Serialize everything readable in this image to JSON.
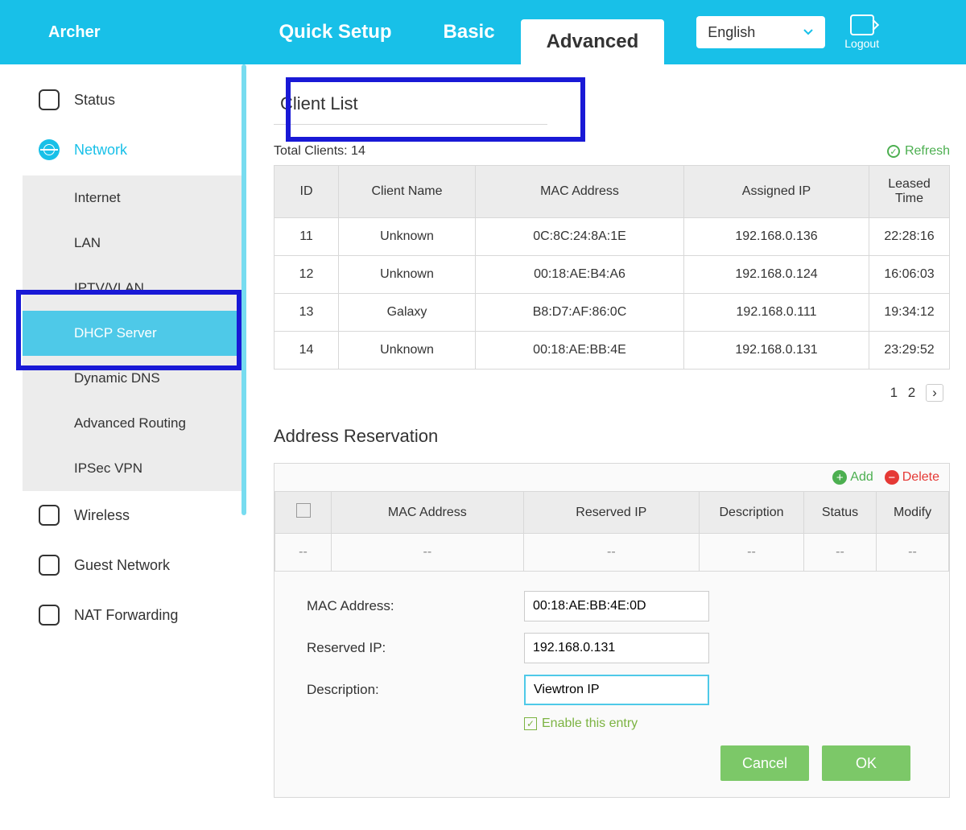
{
  "brand": "Archer",
  "tabs": {
    "quick": "Quick Setup",
    "basic": "Basic",
    "advanced": "Advanced"
  },
  "lang": {
    "value": "English"
  },
  "logout": "Logout",
  "sidebar": {
    "status": "Status",
    "network": "Network",
    "subs": {
      "internet": "Internet",
      "lan": "LAN",
      "iptv": "IPTV/VLAN",
      "dhcp": "DHCP Server",
      "ddns": "Dynamic DNS",
      "advrouting": "Advanced Routing",
      "ipsec": "IPSec VPN"
    },
    "wireless": "Wireless",
    "guest": "Guest Network",
    "nat": "NAT Forwarding"
  },
  "page": {
    "title": "Client List",
    "total_label": "Total Clients: 14",
    "refresh": "Refresh",
    "cols": {
      "id": "ID",
      "name": "Client Name",
      "mac": "MAC Address",
      "ip": "Assigned IP",
      "lease": "Leased Time"
    },
    "rows": [
      {
        "id": "11",
        "name": "Unknown",
        "mac": "0C:8C:24:8A:1E",
        "ip": "192.168.0.136",
        "lease": "22:28:16"
      },
      {
        "id": "12",
        "name": "Unknown",
        "mac": "00:18:AE:B4:A6",
        "ip": "192.168.0.124",
        "lease": "16:06:03"
      },
      {
        "id": "13",
        "name": "Galaxy",
        "mac": "B8:D7:AF:86:0C",
        "ip": "192.168.0.111",
        "lease": "19:34:12"
      },
      {
        "id": "14",
        "name": "Unknown",
        "mac": "00:18:AE:BB:4E",
        "ip": "192.168.0.131",
        "lease": "23:29:52"
      }
    ],
    "pager": {
      "p1": "1",
      "p2": "2",
      "next": "›"
    }
  },
  "resv": {
    "title": "Address Reservation",
    "add": "Add",
    "delete": "Delete",
    "cols": {
      "mac": "MAC Address",
      "ip": "Reserved IP",
      "desc": "Description",
      "status": "Status",
      "modify": "Modify"
    },
    "empty": "--",
    "form": {
      "mac_label": "MAC Address:",
      "mac_val": "00:18:AE:BB:4E:0D",
      "ip_label": "Reserved IP:",
      "ip_val": "192.168.0.131",
      "desc_label": "Description:",
      "desc_val": "Viewtron IP",
      "enable": "Enable this entry",
      "cancel": "Cancel",
      "ok": "OK"
    }
  }
}
